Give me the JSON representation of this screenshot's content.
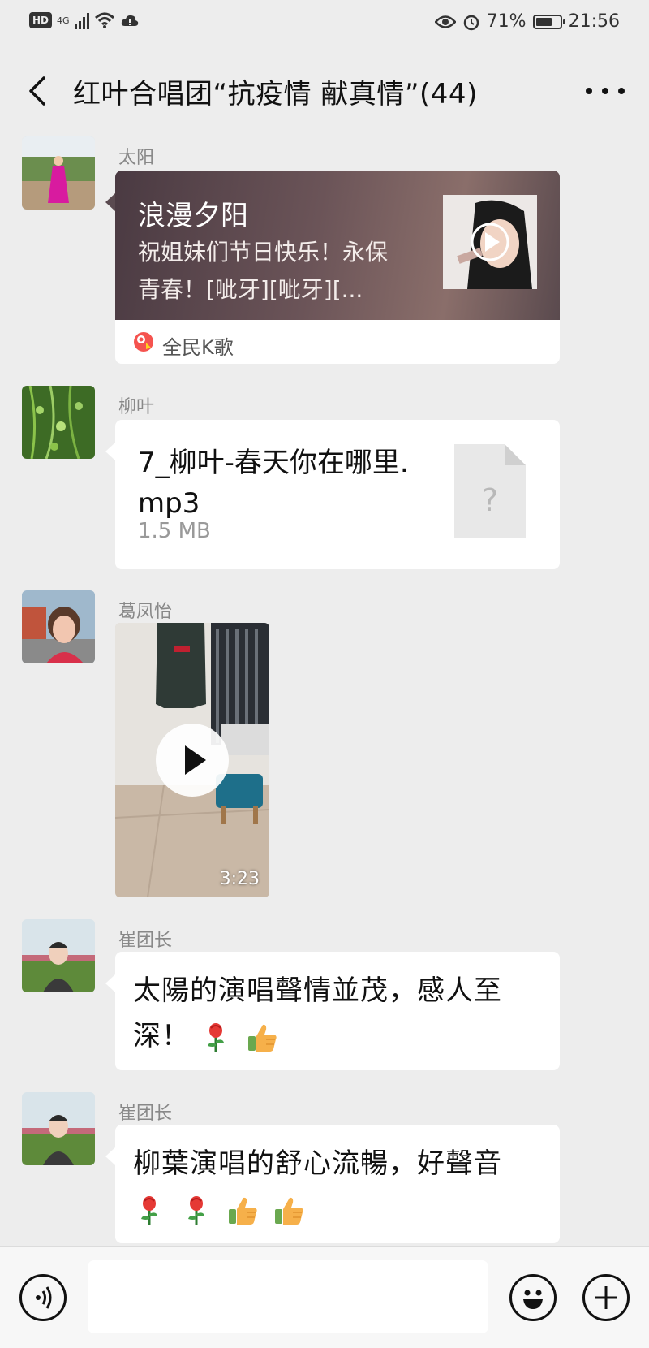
{
  "status_bar": {
    "hd_label": "HD",
    "network_label": "4G",
    "battery_percent": "71%",
    "battery_level": 0.71,
    "time": "21:56",
    "icons": [
      "eye-icon",
      "alarm-icon",
      "wifi-icon",
      "cloud-alert-icon",
      "signal-icon",
      "battery-icon"
    ]
  },
  "header": {
    "title": "红叶合唱团“抗疫情   献真情”(44)",
    "back_icon": "chevron-left-icon",
    "more_icon": "more-dots-icon"
  },
  "messages": [
    {
      "type": "link-card",
      "sender": "太阳",
      "card_title": "浪漫夕阳",
      "card_description": "祝姐妹们节日快乐！永保青春！[呲牙][呲牙][...",
      "source_app": "全民K歌"
    },
    {
      "type": "file",
      "sender": "柳叶",
      "file_name": "7_柳叶-春天你在哪里.mp3",
      "file_size": "1.5 MB",
      "file_icon_glyph": "?"
    },
    {
      "type": "video",
      "sender": "葛凤怡",
      "duration": "3:23"
    },
    {
      "type": "text",
      "sender": "崔团长",
      "text": "太陽的演唱聲情並茂，感人至深！",
      "emojis": [
        "rose-emoji",
        "thumbs-up-emoji"
      ]
    },
    {
      "type": "text",
      "sender": "崔团长",
      "text": "柳葉演唱的舒心流暢，好聲音",
      "emojis": [
        "rose-emoji",
        "rose-emoji",
        "thumbs-up-emoji",
        "thumbs-up-emoji"
      ]
    }
  ],
  "input_bar": {
    "input_value": "",
    "voice_icon": "voice-icon",
    "emoji_icon": "smiley-icon",
    "plus_icon": "plus-icon"
  },
  "colors": {
    "background": "#ededed",
    "bubble": "#ffffff",
    "sender_name": "#888888",
    "input_bar": "#f7f7f7"
  }
}
